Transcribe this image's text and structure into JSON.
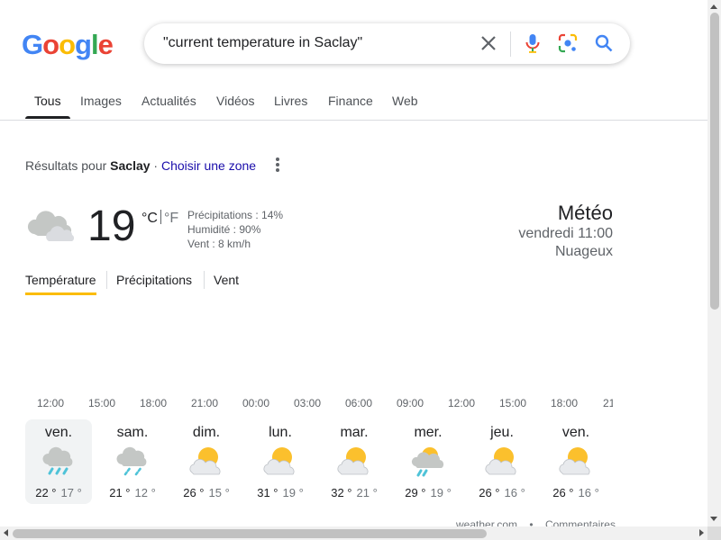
{
  "logo": {
    "text": "Google",
    "letters": [
      "G",
      "o",
      "o",
      "g",
      "l",
      "e"
    ],
    "colors": [
      "#4285F4",
      "#EA4335",
      "#FBBC05",
      "#4285F4",
      "#34A853",
      "#EA4335"
    ]
  },
  "search": {
    "query": "\"current temperature in Saclay\"",
    "icons": [
      "close-icon",
      "mic-icon",
      "lens-icon",
      "search-icon"
    ]
  },
  "tabs": [
    {
      "label": "Tous",
      "active": true
    },
    {
      "label": "Images"
    },
    {
      "label": "Actualités"
    },
    {
      "label": "Vidéos"
    },
    {
      "label": "Livres"
    },
    {
      "label": "Finance"
    },
    {
      "label": "Web"
    }
  ],
  "location": {
    "prefix": "Résultats pour ",
    "place": "Saclay",
    "sep": " · ",
    "link": "Choisir une zone"
  },
  "weather": {
    "temperature": "19",
    "unit_c": "°C",
    "unit_f": "°F",
    "precipitation": "Précipitations : 14%",
    "humidity": "Humidité : 90%",
    "wind": "Vent : 8 km/h",
    "title": "Météo",
    "datetime": "vendredi 11:00",
    "condition": "Nuageux",
    "current_icon": "cloud-icon",
    "tabs": [
      "Température",
      "Précipitations",
      "Vent"
    ],
    "hours": [
      "12:00",
      "15:00",
      "18:00",
      "21:00",
      "00:00",
      "03:00",
      "06:00",
      "09:00",
      "12:00",
      "15:00",
      "18:00",
      "21"
    ],
    "days": [
      {
        "name": "ven.",
        "hi": "22 °",
        "lo": "17 °",
        "icon": "rain-icon",
        "selected": true
      },
      {
        "name": "sam.",
        "hi": "21 °",
        "lo": "12 °",
        "icon": "showers-icon"
      },
      {
        "name": "dim.",
        "hi": "26 °",
        "lo": "15 °",
        "icon": "partly-cloudy-icon"
      },
      {
        "name": "lun.",
        "hi": "31 °",
        "lo": "19 °",
        "icon": "partly-cloudy-icon"
      },
      {
        "name": "mar.",
        "hi": "32 °",
        "lo": "21 °",
        "icon": "partly-cloudy-icon"
      },
      {
        "name": "mer.",
        "hi": "29 °",
        "lo": "19 °",
        "icon": "scattered-showers-icon"
      },
      {
        "name": "jeu.",
        "hi": "26 °",
        "lo": "16 °",
        "icon": "partly-cloudy-icon"
      },
      {
        "name": "ven.",
        "hi": "26 °",
        "lo": "16 °",
        "icon": "partly-cloudy-icon"
      }
    ],
    "footer_source": "weather.com",
    "footer_sep": "•",
    "footer_feedback": "Commentaires"
  },
  "colors": {
    "sun": "#FBBC05",
    "cloud": "#DADCE0",
    "rain": "#4FC3D8",
    "link": "#1a0dab",
    "tab_underline": "#FBBC04"
  }
}
